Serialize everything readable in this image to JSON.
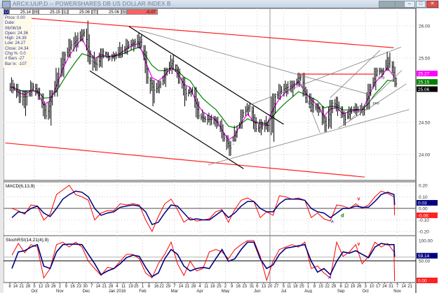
{
  "window": {
    "title": "ARCX:UUP,D -- POWERSHARES DB US DOLLAR INDEX B",
    "buttons": [
      "minimize",
      "maximize",
      "close"
    ]
  },
  "quote_bar": [
    {
      "key": "O",
      "value": "25.14"
    },
    {
      "key": "H",
      "value": "25.15"
    },
    {
      "key": "L",
      "value": "25.06"
    },
    {
      "key": "T",
      "value": "25.06"
    },
    {
      "key": "N",
      "value": "-0.07"
    }
  ],
  "info_panel": [
    "Price: 0.00",
    "Date: 06/06/16",
    "Open: 24.36",
    "High: 24.39",
    "Low: 24.27",
    "Close: 24.34",
    "Chg %: 0.0",
    "# Bars -27",
    "Bar Ix: -107"
  ],
  "colors": {
    "up_line": "#ff0000",
    "fast_ma": "#ff00ff",
    "slow_ma": "#008000",
    "signal": "#000080",
    "bars": "#000000"
  },
  "chart_data": [
    {
      "type": "ohlc",
      "panel": "price",
      "ylim": [
        23.6,
        26.2
      ],
      "yticks": [
        "26.00",
        "25.50",
        "25.00",
        "24.50",
        "24.00"
      ],
      "grid": true,
      "weeks": [
        [
          "2015-09-08",
          25.2,
          24.95,
          25.05
        ],
        [
          "2015-09-15",
          25.1,
          24.8,
          24.9
        ],
        [
          "2015-09-22",
          25.0,
          24.6,
          24.9
        ],
        [
          "2015-09-29",
          25.15,
          24.9,
          25.05
        ],
        [
          "2015-10-06",
          25.1,
          24.85,
          24.95
        ],
        [
          "2015-10-13",
          24.95,
          24.55,
          24.6
        ],
        [
          "2015-10-20",
          25.0,
          24.45,
          24.9
        ],
        [
          "2015-10-27",
          25.35,
          24.9,
          25.25
        ],
        [
          "2015-11-03",
          25.6,
          25.2,
          25.55
        ],
        [
          "2015-11-10",
          25.8,
          25.5,
          25.7
        ],
        [
          "2015-11-17",
          25.9,
          25.6,
          25.8
        ],
        [
          "2015-11-24",
          25.95,
          25.75,
          25.9
        ],
        [
          "2015-12-01",
          26.08,
          25.4,
          25.45
        ],
        [
          "2015-12-08",
          25.6,
          25.3,
          25.4
        ],
        [
          "2015-12-15",
          25.65,
          25.35,
          25.6
        ],
        [
          "2015-12-22",
          25.6,
          25.45,
          25.5
        ],
        [
          "2015-12-29",
          25.6,
          25.45,
          25.55
        ],
        [
          "2016-01-05",
          25.75,
          25.5,
          25.6
        ],
        [
          "2016-01-12",
          25.8,
          25.55,
          25.7
        ],
        [
          "2016-01-19",
          25.8,
          25.6,
          25.75
        ],
        [
          "2016-01-26",
          25.9,
          25.65,
          25.75
        ],
        [
          "2016-02-02",
          25.7,
          25.1,
          25.2
        ],
        [
          "2016-02-09",
          25.2,
          24.75,
          25.0
        ],
        [
          "2016-02-16",
          25.15,
          24.95,
          25.1
        ],
        [
          "2016-02-23",
          25.35,
          25.05,
          25.3
        ],
        [
          "2016-03-01",
          25.55,
          25.25,
          25.45
        ],
        [
          "2016-03-08",
          25.4,
          25.1,
          25.2
        ],
        [
          "2016-03-15",
          25.2,
          24.75,
          24.95
        ],
        [
          "2016-03-22",
          25.05,
          24.9,
          25.0
        ],
        [
          "2016-03-29",
          25.05,
          24.55,
          24.6
        ],
        [
          "2016-04-05",
          24.7,
          24.5,
          24.55
        ],
        [
          "2016-04-12",
          24.65,
          24.45,
          24.55
        ],
        [
          "2016-04-19",
          24.6,
          24.4,
          24.5
        ],
        [
          "2016-04-26",
          24.55,
          24.2,
          24.25
        ],
        [
          "2016-05-03",
          24.3,
          23.98,
          24.1
        ],
        [
          "2016-05-10",
          24.45,
          24.2,
          24.35
        ],
        [
          "2016-05-17",
          24.7,
          24.4,
          24.65
        ],
        [
          "2016-05-24",
          24.8,
          24.6,
          24.75
        ],
        [
          "2016-05-31",
          24.75,
          24.35,
          24.4
        ],
        [
          "2016-06-07",
          24.55,
          24.3,
          24.45
        ],
        [
          "2016-06-14",
          24.6,
          24.35,
          24.45
        ],
        [
          "2016-06-21",
          24.95,
          24.2,
          24.9
        ],
        [
          "2016-06-28",
          25.1,
          24.85,
          25.0
        ],
        [
          "2016-07-05",
          25.15,
          24.9,
          25.05
        ],
        [
          "2016-07-12",
          25.15,
          24.9,
          25.1
        ],
        [
          "2016-07-19",
          25.27,
          25.05,
          25.2
        ],
        [
          "2016-07-26",
          25.27,
          24.8,
          24.85
        ],
        [
          "2016-08-02",
          24.95,
          24.65,
          24.75
        ],
        [
          "2016-08-09",
          24.8,
          24.6,
          24.7
        ],
        [
          "2016-08-16",
          24.75,
          24.35,
          24.45
        ],
        [
          "2016-08-23",
          24.85,
          24.4,
          24.8
        ],
        [
          "2016-08-30",
          24.9,
          24.6,
          24.75
        ],
        [
          "2016-09-06",
          24.75,
          24.45,
          24.55
        ],
        [
          "2016-09-13",
          24.75,
          24.55,
          24.7
        ],
        [
          "2016-09-20",
          24.8,
          24.6,
          24.7
        ],
        [
          "2016-09-27",
          24.8,
          24.6,
          24.7
        ],
        [
          "2016-10-04",
          25.1,
          24.7,
          25.05
        ],
        [
          "2016-10-11",
          25.35,
          25.0,
          25.3
        ],
        [
          "2016-10-18",
          25.35,
          25.2,
          25.3
        ],
        [
          "2016-10-25",
          25.6,
          25.3,
          25.45
        ],
        [
          "2016-11-01",
          25.45,
          25.05,
          25.1
        ]
      ],
      "last_values": {
        "fast_ma": "25.27",
        "slow_ma": "25.15",
        "close": "25.06"
      },
      "trendlines": [
        {
          "color": "red",
          "from": [
            "2015-09-03",
            26.15
          ],
          "to": [
            "2016-11-03",
            25.66
          ]
        },
        {
          "color": "red",
          "from": [
            "2015-09-03",
            24.18
          ],
          "to": [
            "2016-10-02",
            23.65
          ]
        },
        {
          "color": "red",
          "from": [
            "2016-07-21",
            25.25
          ],
          "to": [
            "2016-10-12",
            25.25
          ]
        },
        {
          "color": "black",
          "from": [
            "2016-01-17",
            25.99
          ],
          "to": [
            "2016-07-05",
            24.47
          ]
        },
        {
          "color": "black",
          "from": [
            "2015-12-05",
            25.3
          ],
          "to": [
            "2016-05-22",
            23.78
          ]
        },
        {
          "color": "gray",
          "from": [
            "2016-01-29",
            25.93
          ],
          "to": [
            "2016-10-08",
            24.93
          ]
        },
        {
          "color": "gray",
          "from": [
            "2016-05-23",
            24.74
          ],
          "to": [
            "2016-11-11",
            25.67
          ]
        },
        {
          "color": "gray",
          "from": [
            "2016-04-13",
            23.84
          ],
          "to": [
            "2016-11-20",
            24.7
          ]
        },
        {
          "color": "gray",
          "from": [
            "2016-07-21",
            25.21
          ],
          "to": [
            "2016-08-14",
            24.34
          ]
        },
        {
          "color": "gray",
          "from": [
            "2016-08-25",
            24.88
          ],
          "to": [
            "2016-10-19",
            25.62
          ]
        },
        {
          "color": "gray",
          "from": [
            "2016-09-15",
            24.52
          ],
          "to": [
            "2016-11-12",
            25.31
          ]
        },
        {
          "color": "gray",
          "from": [
            "2016-09-03",
            24.41
          ],
          "to": [
            "2016-11-17",
            25.1
          ]
        }
      ],
      "annotations": [
        {
          "text": "pep",
          "at": [
            "2016-10-17",
            25.18
          ]
        },
        {
          "text": "pep",
          "at": [
            "2016-10-11",
            24.78
          ]
        }
      ]
    },
    {
      "type": "line",
      "panel": "macd",
      "title": "MACD(6,13,9)",
      "ylim": [
        -0.25,
        0.23
      ],
      "yticks": [
        "0.20",
        "0.10",
        "0.00",
        "-0.10",
        "-0.20"
      ],
      "macd": [
        0.0,
        -0.02,
        -0.05,
        0.03,
        0.02,
        -0.1,
        -0.05,
        0.12,
        0.16,
        0.2,
        0.12,
        0.1,
        0.07,
        -0.1,
        -0.04,
        -0.02,
        -0.02,
        0.04,
        0.03,
        0.04,
        0.03,
        -0.1,
        -0.2,
        -0.07,
        0.04,
        0.08,
        -0.01,
        -0.12,
        -0.08,
        -0.11,
        -0.1,
        -0.09,
        -0.03,
        -0.01,
        -0.12,
        -0.01,
        0.07,
        0.09,
        0.06,
        -0.08,
        -0.03,
        -0.06,
        0.11,
        0.1,
        0.08,
        0.09,
        0.07,
        -0.08,
        -0.04,
        -0.09,
        -0.11,
        0.03,
        0.02,
        0.0,
        0.04,
        0.0,
        0.03,
        0.1,
        0.15,
        0.13,
        0.1,
        -0.06
      ],
      "signal": [
        -0.08,
        -0.03,
        -0.04,
        0.0,
        0.02,
        -0.04,
        -0.07,
        0.0,
        0.08,
        0.12,
        0.15,
        0.14,
        0.1,
        0.0,
        -0.06,
        -0.04,
        -0.03,
        0.01,
        0.02,
        0.03,
        0.02,
        -0.03,
        -0.14,
        -0.12,
        -0.04,
        0.03,
        0.02,
        -0.04,
        -0.1,
        -0.09,
        -0.1,
        -0.1,
        -0.06,
        -0.02,
        -0.08,
        -0.04,
        0.02,
        0.06,
        0.06,
        0.0,
        -0.03,
        -0.03,
        0.04,
        0.08,
        0.08,
        0.08,
        0.07,
        0.0,
        -0.03,
        -0.04,
        -0.08,
        -0.04,
        0.0,
        0.0,
        0.02,
        0.01,
        0.01,
        0.06,
        0.12,
        0.14,
        0.12,
        0.03
      ],
      "last_values": {
        "signal": "0.03",
        "macd": "-0.06"
      },
      "annotations": [
        {
          "text": "^",
          "color": "#0000ff",
          "at": [
            "2016-08-26",
            -0.135
          ]
        },
        {
          "text": "d",
          "color": "#008000",
          "at": [
            "2016-09-06",
            -0.075
          ]
        },
        {
          "text": "v",
          "color": "#ff0000",
          "at": [
            "2016-09-24",
            0.07
          ]
        }
      ]
    },
    {
      "type": "line",
      "panel": "stochrsi",
      "title": "StochRSI(14,21(4),9)",
      "ylim": [
        0,
        100
      ],
      "yticks": [
        "100.00",
        "50.00"
      ],
      "fast": [
        64,
        93,
        70,
        90,
        84,
        8,
        31,
        90,
        96,
        84,
        96,
        84,
        49,
        31,
        14,
        34,
        31,
        49,
        66,
        66,
        55,
        20,
        8,
        43,
        66,
        96,
        43,
        14,
        49,
        25,
        31,
        72,
        78,
        72,
        55,
        78,
        90,
        100,
        100,
        61,
        2,
        49,
        78,
        84,
        90,
        84,
        96,
        31,
        37,
        20,
        8,
        96,
        61,
        72,
        90,
        43,
        61,
        96,
        84,
        93,
        72,
        0
      ],
      "slow": [
        31,
        72,
        75,
        84,
        90,
        37,
        31,
        72,
        90,
        91,
        91,
        90,
        66,
        43,
        16,
        25,
        31,
        43,
        58,
        64,
        61,
        34,
        11,
        20,
        55,
        78,
        66,
        37,
        25,
        31,
        34,
        31,
        55,
        78,
        49,
        55,
        78,
        96,
        96,
        55,
        31,
        40,
        66,
        81,
        84,
        87,
        90,
        49,
        22,
        31,
        16,
        49,
        72,
        69,
        75,
        66,
        58,
        84,
        93,
        90,
        90,
        60
      ],
      "last_values": {
        "slow": "59.14",
        "fast": "0.00"
      },
      "annotations": [
        {
          "text": "^",
          "color": "#0000ff",
          "at": [
            "2016-08-23",
            3
          ]
        },
        {
          "text": "v",
          "color": "#ff0000",
          "at": [
            "2016-09-24",
            88
          ]
        }
      ]
    }
  ],
  "indicator_last_date": "2016-11-04",
  "x_axis": {
    "ticks": [
      [
        "2015-09-08",
        "8"
      ],
      [
        "2015-09-14",
        "14"
      ],
      [
        "2015-09-21",
        "21"
      ],
      [
        "2015-09-28",
        "28"
      ],
      [
        "2015-10-05",
        "5"
      ],
      [
        "2015-10-12",
        "12"
      ],
      [
        "2015-10-19",
        "19"
      ],
      [
        "2015-10-26",
        "26"
      ],
      [
        "2015-11-02",
        "2"
      ],
      [
        "2015-11-09",
        "9"
      ],
      [
        "2015-11-16",
        "16"
      ],
      [
        "2015-11-23",
        "23"
      ],
      [
        "2015-11-30",
        "30"
      ],
      [
        "2015-12-07",
        "7"
      ],
      [
        "2015-12-14",
        "14"
      ],
      [
        "2015-12-21",
        "21"
      ],
      [
        "2015-12-28",
        "28"
      ],
      [
        "2016-01-04",
        "4"
      ],
      [
        "2016-01-11",
        "11"
      ],
      [
        "2016-01-19",
        "19"
      ],
      [
        "2016-01-25",
        "25"
      ],
      [
        "2016-02-01",
        "1"
      ],
      [
        "2016-02-08",
        "8"
      ],
      [
        "2016-02-16",
        "16"
      ],
      [
        "2016-02-22",
        "22"
      ],
      [
        "2016-02-29",
        "29"
      ],
      [
        "2016-03-07",
        "7"
      ],
      [
        "2016-03-14",
        "14"
      ],
      [
        "2016-03-21",
        "21"
      ],
      [
        "2016-03-28",
        "28"
      ],
      [
        "2016-04-04",
        "4"
      ],
      [
        "2016-04-11",
        "11"
      ],
      [
        "2016-04-18",
        "18"
      ],
      [
        "2016-04-25",
        "25"
      ],
      [
        "2016-05-02",
        "2"
      ],
      [
        "2016-05-09",
        "9"
      ],
      [
        "2016-05-16",
        "16"
      ],
      [
        "2016-05-23",
        "23"
      ],
      [
        "2016-05-31",
        "31"
      ],
      [
        "2016-06-06",
        "6"
      ],
      [
        "2016-06-13",
        "13"
      ],
      [
        "2016-06-20",
        "20"
      ],
      [
        "2016-06-27",
        "27"
      ],
      [
        "2016-07-05",
        "5"
      ],
      [
        "2016-07-11",
        "11"
      ],
      [
        "2016-07-18",
        "18"
      ],
      [
        "2016-07-25",
        "25"
      ],
      [
        "2016-08-01",
        "1"
      ],
      [
        "2016-08-08",
        "8"
      ],
      [
        "2016-08-15",
        "15"
      ],
      [
        "2016-08-22",
        "22"
      ],
      [
        "2016-08-29",
        "29"
      ],
      [
        "2016-09-06",
        "6"
      ],
      [
        "2016-09-12",
        "12"
      ],
      [
        "2016-09-19",
        "19"
      ],
      [
        "2016-09-26",
        "26"
      ],
      [
        "2016-10-03",
        "3"
      ],
      [
        "2016-10-10",
        "10"
      ],
      [
        "2016-10-17",
        "17"
      ],
      [
        "2016-10-24",
        "24"
      ],
      [
        "2016-10-31",
        "31"
      ],
      [
        "2016-11-07",
        "7"
      ],
      [
        "2016-11-14",
        "14"
      ],
      [
        "2016-11-21",
        "21"
      ]
    ],
    "months": [
      [
        "2015-10-05",
        "Oct"
      ],
      [
        "2015-11-02",
        "Nov"
      ],
      [
        "2015-12-01",
        "Dec"
      ],
      [
        "2016-01-04",
        "Jan 2016"
      ],
      [
        "2016-02-01",
        "Feb"
      ],
      [
        "2016-03-07",
        "Mar"
      ],
      [
        "2016-04-04",
        "Apr"
      ],
      [
        "2016-05-02",
        "May"
      ],
      [
        "2016-06-06",
        "Jun"
      ],
      [
        "2016-07-05",
        "Jul"
      ],
      [
        "2016-08-01",
        "Aug"
      ],
      [
        "2016-09-06",
        "Sep"
      ],
      [
        "2016-10-03",
        "Oct"
      ],
      [
        "2016-11-07",
        "Nov"
      ]
    ]
  }
}
